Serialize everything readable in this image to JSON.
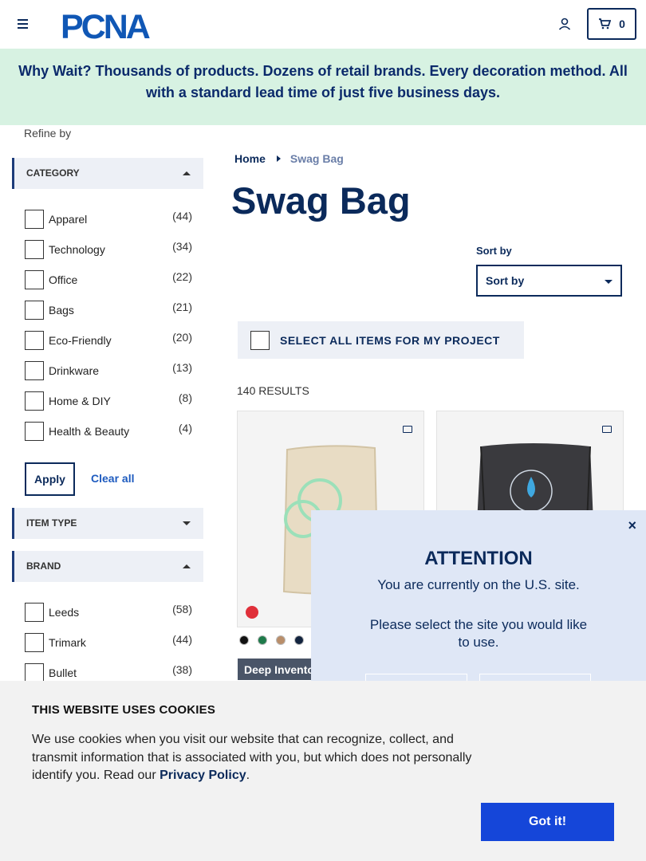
{
  "header": {
    "logo_text": "PCNA",
    "cart_count": "0"
  },
  "banner": {
    "line1": "Why Wait? Thousands of products. Dozens of retail brands. Every decoration method. All",
    "line2": "with a standard lead time of just five business days."
  },
  "sidebar": {
    "refine_label": "Refine by",
    "category": {
      "title": "CATEGORY",
      "items": [
        {
          "label": "Apparel",
          "count": "(44)"
        },
        {
          "label": "Technology",
          "count": "(34)"
        },
        {
          "label": "Office",
          "count": "(22)"
        },
        {
          "label": "Bags",
          "count": "(21)"
        },
        {
          "label": "Eco-Friendly",
          "count": "(20)"
        },
        {
          "label": "Drinkware",
          "count": "(13)"
        },
        {
          "label": "Home & DIY",
          "count": "(8)"
        },
        {
          "label": "Health & Beauty",
          "count": "(4)"
        }
      ]
    },
    "apply_label": "Apply",
    "clear_label": "Clear all",
    "item_type": {
      "title": "ITEM TYPE"
    },
    "brand": {
      "title": "BRAND",
      "items": [
        {
          "label": "Leeds",
          "count": "(58)"
        },
        {
          "label": "Trimark",
          "count": "(44)"
        },
        {
          "label": "Bullet",
          "count": "(38)"
        }
      ]
    }
  },
  "breadcrumb": {
    "home": "Home",
    "current": "Swag Bag"
  },
  "page_title": "Swag Bag",
  "sort": {
    "label": "Sort by",
    "value": "Sort by"
  },
  "select_all": "SELECT ALL ITEMS FOR MY PROJECT",
  "results": "140 RESULTS",
  "product1": {
    "badge": "Deep Invento",
    "swatch_colors": [
      "#111111",
      "#1e7a4a",
      "#b98e6a",
      "#13243f"
    ]
  },
  "modal": {
    "title": "ATTENTION",
    "line1": "You are currently on the U.S. site.",
    "line2": "Please select the site you would like to use.",
    "close": "×"
  },
  "cookie": {
    "title": "THIS WEBSITE USES COOKIES",
    "text": "We use cookies when you visit our website that can recognize, collect, and transmit information that is associated with you, but which does not personally identify you. Read our ",
    "link": "Privacy Policy",
    "period": ".",
    "button": "Got it!"
  },
  "colors": {
    "navy": "#0b2a5b",
    "banner_bg": "#d7f2e2",
    "accept_blue": "#1546d9"
  }
}
